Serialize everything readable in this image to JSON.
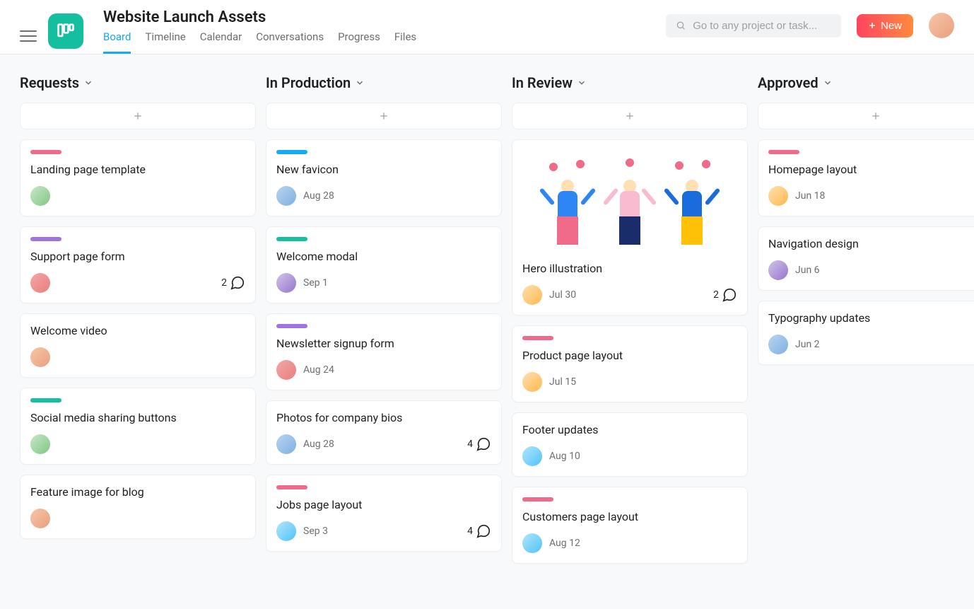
{
  "header": {
    "title": "Website Launch Assets",
    "search_placeholder": "Go to any project or task...",
    "new_btn": "New",
    "tabs": [
      "Board",
      "Timeline",
      "Calendar",
      "Conversations",
      "Progress",
      "Files"
    ],
    "active_tab": 0
  },
  "columns": [
    {
      "title": "Requests",
      "cards": [
        {
          "tag": "pink",
          "title": "Landing page template",
          "avatar": "av-4",
          "date": "",
          "comments": null
        },
        {
          "tag": "purple",
          "title": "Support page form",
          "avatar": "av-2",
          "date": "",
          "comments": 2
        },
        {
          "tag": "",
          "title": "Welcome video",
          "avatar": "av-3",
          "date": "",
          "comments": null
        },
        {
          "tag": "teal",
          "title": "Social media sharing buttons",
          "avatar": "av-4",
          "date": "",
          "comments": null
        },
        {
          "tag": "",
          "title": "Feature image for blog",
          "avatar": "av-3",
          "date": "",
          "comments": null
        }
      ]
    },
    {
      "title": "In Production",
      "cards": [
        {
          "tag": "blue",
          "title": "New favicon",
          "avatar": "av-1",
          "date": "Aug 28",
          "comments": null
        },
        {
          "tag": "teal",
          "title": "Welcome modal",
          "avatar": "av-5",
          "date": "Sep 1",
          "comments": null
        },
        {
          "tag": "purple",
          "title": "Newsletter signup form",
          "avatar": "av-2",
          "date": "Aug 24",
          "comments": null
        },
        {
          "tag": "",
          "title": "Photos for company bios",
          "avatar": "av-1",
          "date": "Aug 28",
          "comments": 4
        },
        {
          "tag": "pink",
          "title": "Jobs page layout",
          "avatar": "av-7",
          "date": "Sep 3",
          "comments": 4
        }
      ]
    },
    {
      "title": "In Review",
      "cards": [
        {
          "tag": "",
          "title": "Hero illustration",
          "avatar": "av-6",
          "date": "Jul 30",
          "comments": 2,
          "image": true
        },
        {
          "tag": "pink",
          "title": "Product page layout",
          "avatar": "av-6",
          "date": "Jul 15",
          "comments": null
        },
        {
          "tag": "",
          "title": "Footer updates",
          "avatar": "av-7",
          "date": "Aug 10",
          "comments": null
        },
        {
          "tag": "pink",
          "title": "Customers page layout",
          "avatar": "av-7",
          "date": "Aug 12",
          "comments": null
        }
      ]
    },
    {
      "title": "Approved",
      "cards": [
        {
          "tag": "pink",
          "title": "Homepage layout",
          "avatar": "av-6",
          "date": "Jun 18",
          "comments": null
        },
        {
          "tag": "",
          "title": "Navigation design",
          "avatar": "av-5",
          "date": "Jun 6",
          "comments": null
        },
        {
          "tag": "",
          "title": "Typography updates",
          "avatar": "av-1",
          "date": "Jun 2",
          "comments": null
        }
      ]
    }
  ]
}
